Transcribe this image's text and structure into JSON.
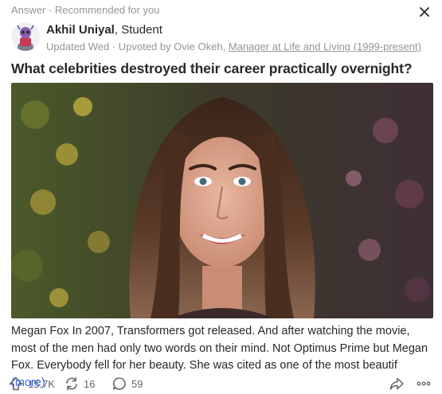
{
  "header": {
    "context_label": "Answer · Recommended for you",
    "close_icon": "close-icon"
  },
  "author": {
    "name": "Akhil Uniyal",
    "credential": ", Student",
    "updated": "Updated Wed · Upvoted by Ovie Okeh, ",
    "upvoter_credential": "Manager at Life and Living (1999-present)"
  },
  "question": {
    "title": "What celebrities destroyed their career practically overnight?"
  },
  "answer": {
    "text": "Megan Fox In 2007, Transformers got released. And after watching the movie, most of the men had only two words on their mind. Not Optimus Prime but Megan Fox. Everybody fell for her beauty. She was cited as one of the most beautif",
    "more_label": "(more)"
  },
  "actions": {
    "upvotes": "15.7K",
    "reshares": "16",
    "comments": "59"
  },
  "colors": {
    "link": "#2e69ff",
    "muted": "#939598",
    "text": "#282829"
  }
}
